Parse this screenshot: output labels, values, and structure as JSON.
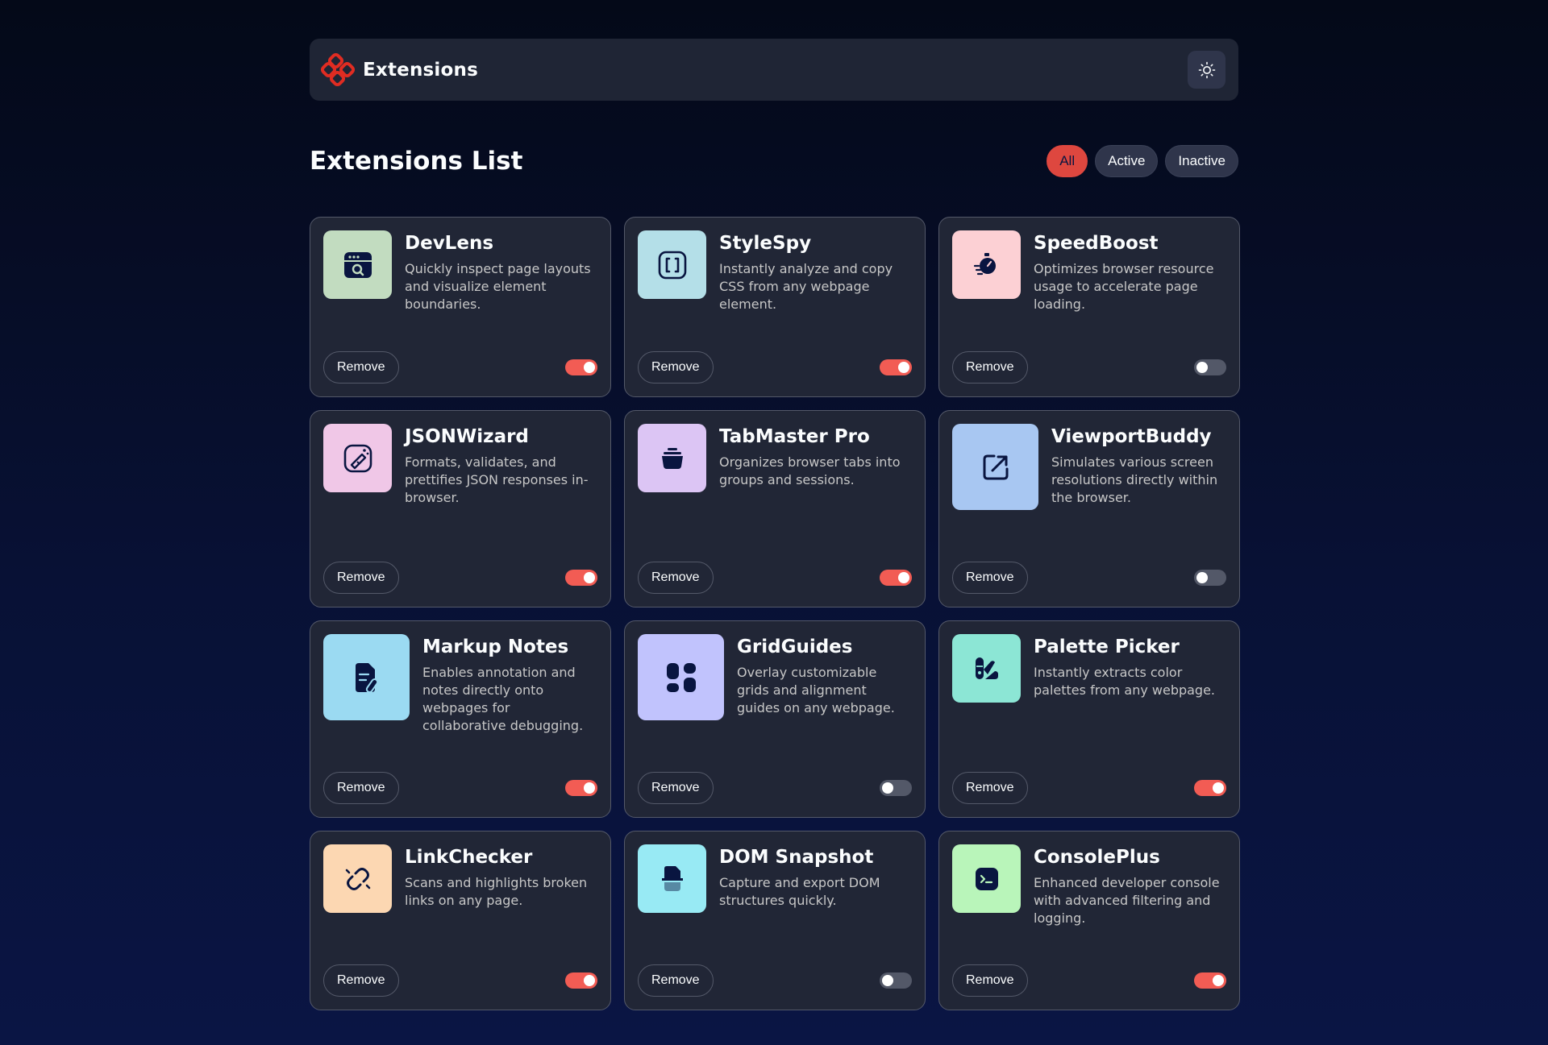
{
  "header": {
    "brand": "Extensions",
    "logo_icon": "extensions-logo-icon",
    "theme_icon": "sun-icon"
  },
  "main": {
    "title": "Extensions List",
    "filters": [
      {
        "label": "All",
        "active": true
      },
      {
        "label": "Active",
        "active": false
      },
      {
        "label": "Inactive",
        "active": false
      }
    ]
  },
  "extensions": [
    {
      "name": "DevLens",
      "description": "Quickly inspect page layouts and visualize element boundaries.",
      "icon": "browser-search-icon",
      "tile_color": "#c2dcc0",
      "enabled": true,
      "remove_label": "Remove"
    },
    {
      "name": "StyleSpy",
      "description": "Instantly analyze and copy CSS from any webpage element.",
      "icon": "brackets-icon",
      "tile_color": "#b4dfe8",
      "enabled": true,
      "remove_label": "Remove"
    },
    {
      "name": "SpeedBoost",
      "description": "Optimizes browser resource usage to accelerate page loading.",
      "icon": "stopwatch-icon",
      "tile_color": "#fcd0d4",
      "enabled": false,
      "remove_label": "Remove"
    },
    {
      "name": "JSONWizard",
      "description": "Formats, validates, and prettifies JSON responses in-browser.",
      "icon": "magic-wand-icon",
      "tile_color": "#f0c7e7",
      "enabled": true,
      "remove_label": "Remove"
    },
    {
      "name": "TabMaster Pro",
      "description": "Organizes browser tabs into groups and sessions.",
      "icon": "stack-icon",
      "tile_color": "#dcc5f4",
      "enabled": true,
      "remove_label": "Remove"
    },
    {
      "name": "ViewportBuddy",
      "description": "Simulates various screen resolutions directly within the browser.",
      "icon": "expand-arrow-icon",
      "tile_color": "#a8c7f2",
      "enabled": false,
      "remove_label": "Remove"
    },
    {
      "name": "Markup Notes",
      "description": "Enables annotation and notes directly onto webpages for collaborative debugging.",
      "icon": "note-pen-icon",
      "tile_color": "#9bdaf2",
      "enabled": true,
      "remove_label": "Remove"
    },
    {
      "name": "GridGuides",
      "description": "Overlay customizable grids and alignment guides on any webpage.",
      "icon": "grid-layout-icon",
      "tile_color": "#c1c3fd",
      "enabled": false,
      "remove_label": "Remove"
    },
    {
      "name": "Palette Picker",
      "description": "Instantly extracts color palettes from any webpage.",
      "icon": "palette-icon",
      "tile_color": "#8ce6d5",
      "enabled": true,
      "remove_label": "Remove"
    },
    {
      "name": "LinkChecker",
      "description": "Scans and highlights broken links on any page.",
      "icon": "broken-link-icon",
      "tile_color": "#fcd7b2",
      "enabled": true,
      "remove_label": "Remove"
    },
    {
      "name": "DOM Snapshot",
      "description": "Capture and export DOM structures quickly.",
      "icon": "snapshot-icon",
      "tile_color": "#98eaf4",
      "enabled": false,
      "remove_label": "Remove"
    },
    {
      "name": "ConsolePlus",
      "description": "Enhanced developer console with advanced filtering and logging.",
      "icon": "terminal-icon",
      "tile_color": "#b9f5ba",
      "enabled": true,
      "remove_label": "Remove"
    }
  ]
}
